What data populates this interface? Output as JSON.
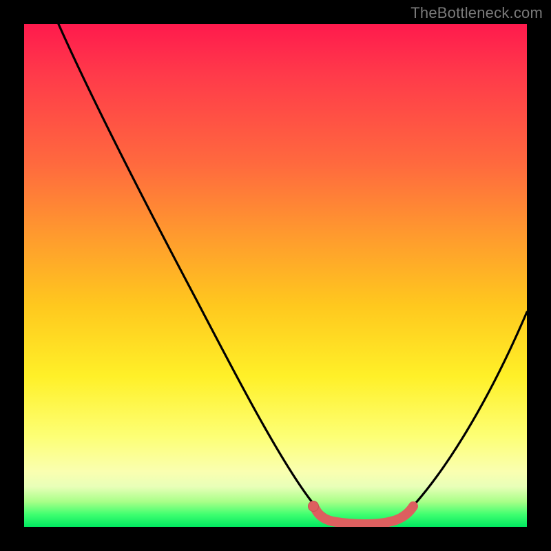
{
  "watermark": "TheBottleneck.com",
  "colors": {
    "curve": "#000000",
    "marker_fill": "#dd5f5f",
    "marker_stroke": "#b84848",
    "gradient_top": "#ff1a4d",
    "gradient_bottom": "#00e860",
    "frame": "#000000"
  },
  "chart_data": {
    "type": "line",
    "title": "",
    "xlabel": "",
    "ylabel": "",
    "xlim": [
      0,
      100
    ],
    "ylim": [
      0,
      100
    ],
    "annotations": [
      "TheBottleneck.com"
    ],
    "legend": [],
    "series": [
      {
        "name": "bottleneck-curve",
        "x": [
          0,
          5,
          10,
          15,
          20,
          25,
          30,
          35,
          40,
          45,
          50,
          55,
          58,
          60,
          63,
          66,
          70,
          73,
          76,
          80,
          85,
          90,
          95,
          100
        ],
        "y": [
          100,
          92,
          84,
          76,
          68,
          59,
          50,
          41,
          32,
          23,
          15,
          8,
          4,
          2,
          1,
          0,
          0,
          1,
          3,
          7,
          14,
          23,
          33,
          43
        ]
      },
      {
        "name": "sweet-spot-band",
        "x": [
          58,
          60,
          63,
          66,
          70,
          73,
          76
        ],
        "y": [
          2.5,
          1.8,
          1.2,
          1.0,
          1.0,
          1.3,
          2.2
        ]
      }
    ],
    "markers": [
      {
        "name": "sweet-spot-start-dot",
        "x": 57.5,
        "y": 3.0
      }
    ]
  }
}
